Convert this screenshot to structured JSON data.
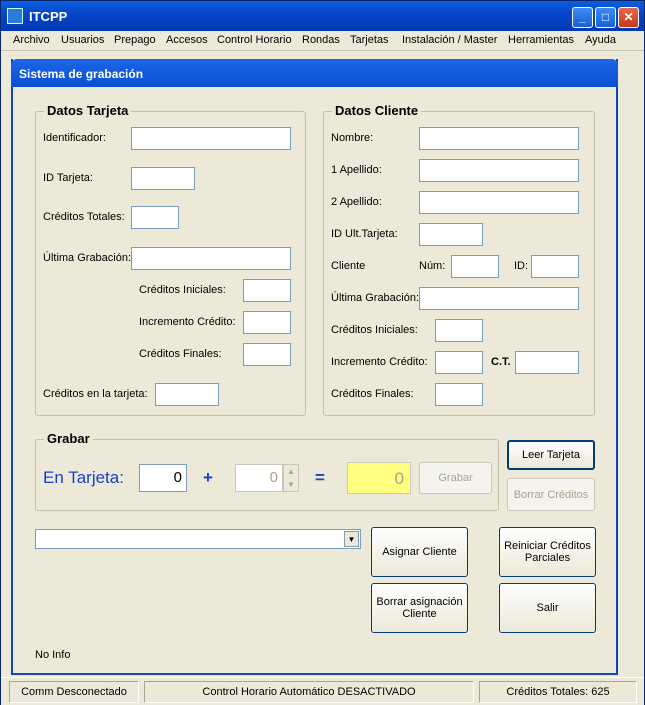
{
  "window": {
    "title": "ITCPP",
    "min": "_",
    "max": "□",
    "close": "✕"
  },
  "menu": [
    "Archivo",
    "Usuarios",
    "Prepago",
    "Accesos",
    "Control Horario",
    "Rondas",
    "Tarjetas",
    "Instalación / Master",
    "Herramientas",
    "Ayuda"
  ],
  "panel_title": "Sistema de grabación",
  "tarjeta": {
    "group": "Datos Tarjeta",
    "identificador": "Identificador:",
    "id_tarjeta": "ID Tarjeta:",
    "creditos_totales": "Créditos Totales:",
    "ultima_grabacion": "Última Grabación:",
    "creditos_iniciales": "Créditos Iniciales:",
    "incremento": "Incremento Crédito:",
    "creditos_finales": "Créditos Finales:",
    "creditos_tarjeta": "Créditos en la tarjeta:"
  },
  "cliente": {
    "group": "Datos Cliente",
    "nombre": "Nombre:",
    "apellido1": "1 Apellido:",
    "apellido2": "2 Apellido:",
    "id_ult": "ID Ult.Tarjeta:",
    "cliente": "Cliente",
    "num": "Núm:",
    "id": "ID:",
    "ultima_grabacion": "Última Grabación:",
    "creditos_iniciales": "Créditos Iniciales:",
    "incremento": "Incremento Crédito:",
    "ct": "C.T.",
    "creditos_finales": "Créditos Finales:"
  },
  "grabar": {
    "group": "Grabar",
    "en_tarjeta": "En Tarjeta:",
    "value1": "0",
    "plus": "+",
    "value2": "0",
    "equals": "=",
    "result": "0",
    "grabar_btn": "Grabar"
  },
  "buttons": {
    "leer": "Leer Tarjeta",
    "borrar_creditos": "Borrar Créditos",
    "asignar": "Asignar Cliente",
    "reiniciar": "Reiniciar Créditos Parciales",
    "borrar_asig": "Borrar asignación Cliente",
    "salir": "Salir"
  },
  "info": "No Info",
  "status": {
    "comm": "Comm Desconectado",
    "control": "Control Horario Automático DESACTIVADO",
    "creditos": "Créditos Totales: 625"
  }
}
